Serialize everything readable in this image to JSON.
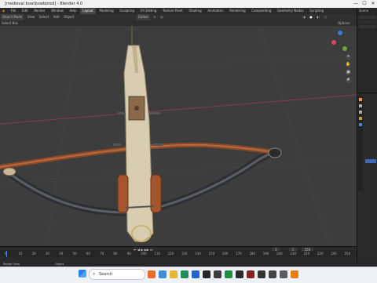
{
  "window": {
    "title": "[medieval bow\\bowbored] - Blender 4.0",
    "controls": [
      "—",
      "☐",
      "✕"
    ]
  },
  "menubar": {
    "items": [
      "File",
      "Edit",
      "Render",
      "Window",
      "Help"
    ],
    "workspaces": [
      "Layout",
      "Modeling",
      "Sculpting",
      "UV Editing",
      "Texture Paint",
      "Shading",
      "Animation",
      "Rendering",
      "Compositing",
      "Geometry Nodes",
      "Scripting"
    ],
    "active_workspace": "Layout",
    "scene": "Scene"
  },
  "viewport_header": {
    "mode": "Object Mode",
    "menus": [
      "View",
      "Select",
      "Add",
      "Object"
    ],
    "transform": "Global",
    "options": "Options",
    "select_box": "Select Box"
  },
  "timeline": {
    "frame_numbers": [
      "0",
      "10",
      "20",
      "30",
      "40",
      "50",
      "60",
      "70",
      "80",
      "90",
      "100",
      "110",
      "120",
      "130",
      "140",
      "150",
      "160",
      "170",
      "180",
      "190",
      "200",
      "210",
      "220",
      "230",
      "240",
      "250"
    ],
    "current_frame": "1",
    "start": "1",
    "end": "250",
    "start_label": "Start",
    "end_label": "End"
  },
  "statusbar": {
    "left": "Rotate View",
    "mid": "Object"
  },
  "taskbar": {
    "search_placeholder": "Search"
  }
}
